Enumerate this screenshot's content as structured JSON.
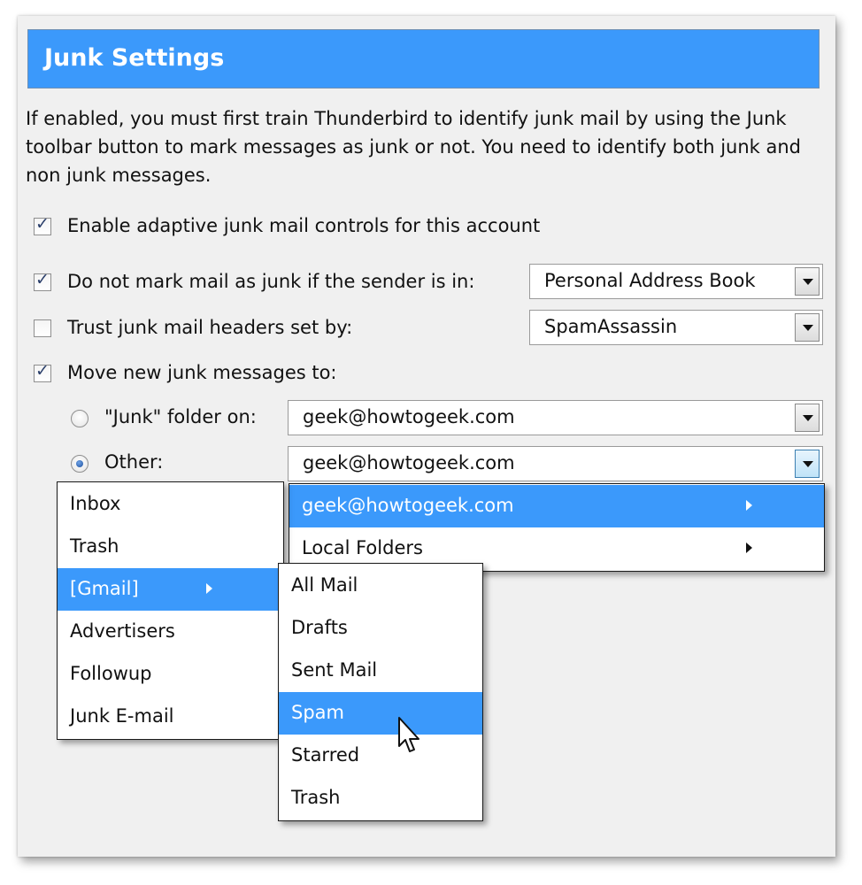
{
  "header": {
    "title": "Junk Settings"
  },
  "description": "If enabled, you must first train Thunderbird to identify junk mail by using the Junk toolbar button to mark messages as junk or not. You need to identify both junk and non junk messages.",
  "options": {
    "enable_adaptive": {
      "label": "Enable adaptive junk mail controls for this account",
      "checked": true
    },
    "do_not_mark": {
      "label": "Do not mark mail as junk if the sender is in:",
      "checked": true,
      "select_value": "Personal Address Book"
    },
    "trust_headers": {
      "label": "Trust junk mail headers set by:",
      "checked": false,
      "select_value": "SpamAssassin"
    },
    "move_junk": {
      "label": "Move new junk messages to:",
      "checked": true
    },
    "junk_folder": {
      "label": "\"Junk\" folder on:",
      "selected": false,
      "select_value": "geek@howtogeek.com"
    },
    "other": {
      "label": "Other:",
      "selected": true,
      "select_value": "geek@howtogeek.com"
    }
  },
  "account_menu": {
    "items": [
      {
        "label": "geek@howtogeek.com",
        "highlighted": true,
        "submenu": true
      },
      {
        "label": "Local Folders",
        "highlighted": false,
        "submenu": true
      }
    ]
  },
  "folder_menu": {
    "items": [
      {
        "label": "Inbox"
      },
      {
        "label": "Trash"
      },
      {
        "label": "[Gmail]",
        "highlighted": true,
        "submenu": true
      },
      {
        "label": "Advertisers"
      },
      {
        "label": "Followup"
      },
      {
        "label": "Junk E-mail"
      }
    ]
  },
  "gmail_menu": {
    "items": [
      {
        "label": "All Mail"
      },
      {
        "label": "Drafts"
      },
      {
        "label": "Sent Mail"
      },
      {
        "label": "Spam",
        "highlighted": true
      },
      {
        "label": "Starred"
      },
      {
        "label": "Trash"
      }
    ]
  },
  "colors": {
    "accent": "#3b99fb",
    "panel": "#f0f0f0"
  }
}
